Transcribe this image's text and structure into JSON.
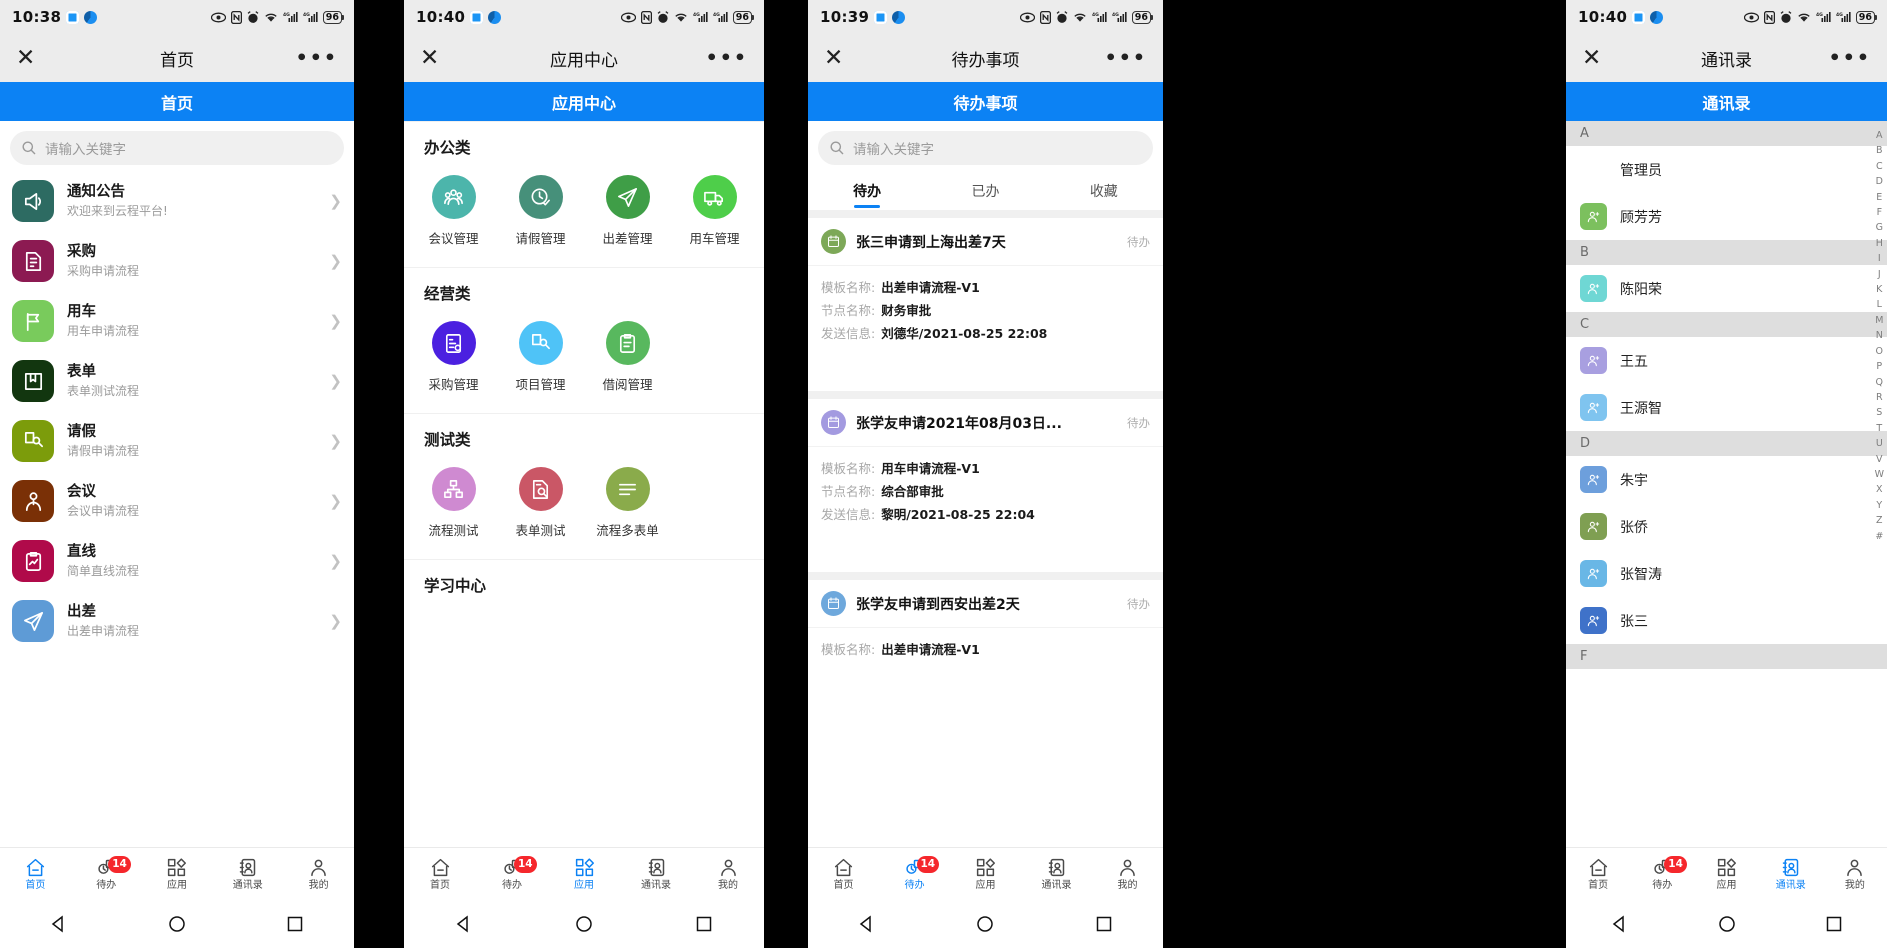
{
  "status": {
    "time1": "10:38",
    "time2": "10:40",
    "time3": "10:39",
    "time4": "10:40",
    "battery": "96"
  },
  "panel1": {
    "titlebar": {
      "title": "首页",
      "close": "✕",
      "more": "•••"
    },
    "app_header": "首页",
    "search_placeholder": "请输入关键字",
    "items": [
      {
        "title": "通知公告",
        "sub": "欢迎来到云程平台!",
        "color": "#2d6b62",
        "icon": "megaphone-icon"
      },
      {
        "title": "采购",
        "sub": "采购申请流程",
        "color": "#8c1a52",
        "icon": "document-edit-icon"
      },
      {
        "title": "用车",
        "sub": "用车申请流程",
        "color": "#79cb5c",
        "icon": "flag-icon"
      },
      {
        "title": "表单",
        "sub": "表单测试流程",
        "color": "#12360f",
        "icon": "book-icon"
      },
      {
        "title": "请假",
        "sub": "请假申请流程",
        "color": "#7c9c0b",
        "icon": "person-doc-icon"
      },
      {
        "title": "会议",
        "sub": "会议申请流程",
        "color": "#7a3006",
        "icon": "person-tie-icon"
      },
      {
        "title": "直线",
        "sub": "简单直线流程",
        "color": "#b00a4a",
        "icon": "clipboard-chart-icon"
      },
      {
        "title": "出差",
        "sub": "出差申请流程",
        "color": "#5e9bd6",
        "icon": "paper-plane-icon"
      }
    ],
    "tabs": [
      {
        "label": "首页",
        "icon": "home-icon",
        "active": true,
        "badge": ""
      },
      {
        "label": "待办",
        "icon": "todo-icon",
        "active": false,
        "badge": "14"
      },
      {
        "label": "应用",
        "icon": "apps-icon",
        "active": false,
        "badge": ""
      },
      {
        "label": "通讯录",
        "icon": "contacts-icon",
        "active": false,
        "badge": ""
      },
      {
        "label": "我的",
        "icon": "person-icon",
        "active": false,
        "badge": ""
      }
    ]
  },
  "panel2": {
    "titlebar": {
      "title": "应用中心",
      "close": "✕",
      "more": "•••"
    },
    "app_header": "应用中心",
    "sections": [
      {
        "title": "办公类",
        "apps": [
          {
            "label": "会议管理",
            "color": "#4cb5ab",
            "icon": "meeting-icon"
          },
          {
            "label": "请假管理",
            "color": "#46907a",
            "icon": "clock-check-icon"
          },
          {
            "label": "出差管理",
            "color": "#3f9e47",
            "icon": "paper-plane-icon"
          },
          {
            "label": "用车管理",
            "color": "#4ece4a",
            "icon": "truck-icon"
          }
        ]
      },
      {
        "title": "经营类",
        "apps": [
          {
            "label": "采购管理",
            "color": "#4b20e0",
            "icon": "contract-icon"
          },
          {
            "label": "项目管理",
            "color": "#4fc3f7",
            "icon": "person-doc-icon"
          },
          {
            "label": "借阅管理",
            "color": "#58b85e",
            "icon": "clipboard-icon"
          }
        ]
      },
      {
        "title": "测试类",
        "apps": [
          {
            "label": "流程测试",
            "color": "#cf8ad1",
            "icon": "sitemap-icon"
          },
          {
            "label": "表单测试",
            "color": "#ca5766",
            "icon": "doc-search-icon"
          },
          {
            "label": "流程多表单",
            "color": "#8aab4b",
            "icon": "list-lines-icon"
          }
        ]
      },
      {
        "title": "学习中心",
        "apps": []
      }
    ],
    "tabs": [
      {
        "label": "首页",
        "icon": "home-icon",
        "active": false,
        "badge": ""
      },
      {
        "label": "待办",
        "icon": "todo-icon",
        "active": false,
        "badge": "14"
      },
      {
        "label": "应用",
        "icon": "apps-icon",
        "active": true,
        "badge": ""
      },
      {
        "label": "通讯录",
        "icon": "contacts-icon",
        "active": false,
        "badge": ""
      },
      {
        "label": "我的",
        "icon": "person-icon",
        "active": false,
        "badge": ""
      }
    ]
  },
  "panel3": {
    "titlebar": {
      "title": "待办事项",
      "close": "✕",
      "more": "•••"
    },
    "app_header": "待办事项",
    "search_placeholder": "请输入关键字",
    "tabs": [
      {
        "label": "待办",
        "active": true
      },
      {
        "label": "已办",
        "active": false
      },
      {
        "label": "收藏",
        "active": false
      }
    ],
    "key_template": "模板名称:",
    "key_node": "节点名称:",
    "key_sender": "发送信息:",
    "cards": [
      {
        "title": "张三申请到上海出差7天",
        "status": "待办",
        "avatar_color": "#7da858",
        "template": "出差申请流程-V1",
        "node": "财务审批",
        "sender": "刘德华/2021-08-25 22:08"
      },
      {
        "title": "张学友申请2021年08月03日...",
        "status": "待办",
        "avatar_color": "#a39ae0",
        "template": "用车申请流程-V1",
        "node": "综合部审批",
        "sender": "黎明/2021-08-25 22:04"
      },
      {
        "title": "张学友申请到西安出差2天",
        "status": "待办",
        "avatar_color": "#6ea8dc",
        "template": "出差申请流程-V1",
        "node": "",
        "sender": ""
      }
    ],
    "tabs_bottom": [
      {
        "label": "首页",
        "icon": "home-icon",
        "active": false,
        "badge": ""
      },
      {
        "label": "待办",
        "icon": "todo-icon",
        "active": true,
        "badge": "14"
      },
      {
        "label": "应用",
        "icon": "apps-icon",
        "active": false,
        "badge": ""
      },
      {
        "label": "通讯录",
        "icon": "contacts-icon",
        "active": false,
        "badge": ""
      },
      {
        "label": "我的",
        "icon": "person-icon",
        "active": false,
        "badge": ""
      }
    ]
  },
  "panel4": {
    "titlebar": {
      "title": "通讯录",
      "close": "✕",
      "more": "•••"
    },
    "app_header": "通讯录",
    "groups": [
      {
        "letter": "A",
        "contacts": [
          {
            "name": "管理员",
            "color": "#f5a council"
          },
          {
            "name": "顾芳芳",
            "color": "#7cc05e"
          }
        ]
      },
      {
        "letter": "B",
        "contacts": [
          {
            "name": "陈阳荣",
            "color": "#6fd7d4"
          }
        ]
      },
      {
        "letter": "C",
        "contacts": [
          {
            "name": "王五",
            "color": "#a89fe0"
          },
          {
            "name": "王源智",
            "color": "#7fc4ef"
          }
        ]
      },
      {
        "letter": "D",
        "contacts": [
          {
            "name": "朱宇",
            "color": "#6d9fdc"
          },
          {
            "name": "张侨",
            "color": "#7f9f52"
          },
          {
            "name": "张智涛",
            "color": "#69b7e6"
          },
          {
            "name": "张三",
            "color": "#3f72c9"
          }
        ]
      },
      {
        "letter": "F",
        "contacts": []
      }
    ],
    "index": [
      "A",
      "B",
      "C",
      "D",
      "E",
      "F",
      "G",
      "H",
      "I",
      "J",
      "K",
      "L",
      "M",
      "N",
      "O",
      "P",
      "Q",
      "R",
      "S",
      "T",
      "U",
      "V",
      "W",
      "X",
      "Y",
      "Z",
      "#"
    ],
    "tabs_bottom": [
      {
        "label": "首页",
        "icon": "home-icon",
        "active": false,
        "badge": ""
      },
      {
        "label": "待办",
        "icon": "todo-icon",
        "active": false,
        "badge": "14"
      },
      {
        "label": "应用",
        "icon": "apps-icon",
        "active": false,
        "badge": ""
      },
      {
        "label": "通讯录",
        "icon": "contacts-icon",
        "active": true,
        "badge": ""
      },
      {
        "label": "我的",
        "icon": "person-icon",
        "active": false,
        "badge": ""
      }
    ]
  },
  "colors": {
    "accent": "#0c82f4",
    "badge": "#f5272c",
    "header_bg": "#ececec"
  }
}
